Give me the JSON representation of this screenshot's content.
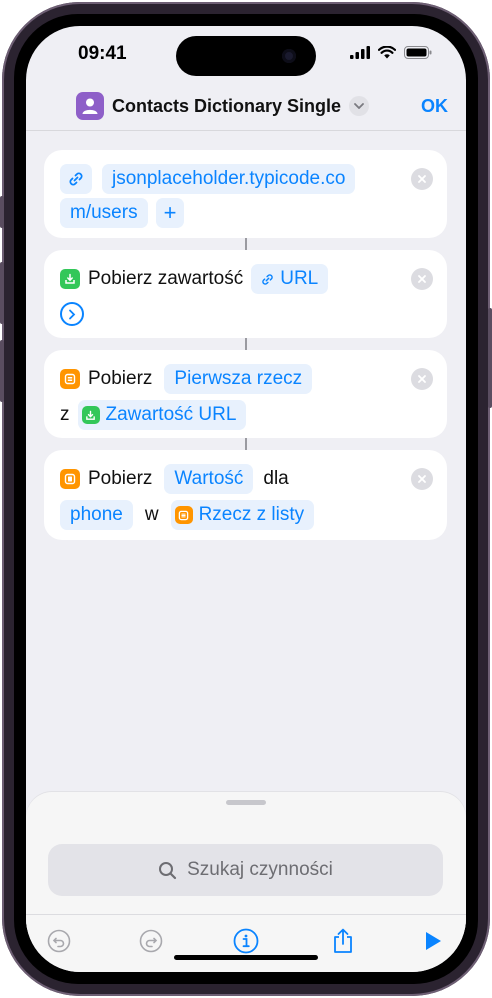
{
  "status_bar": {
    "time": "09:41"
  },
  "nav": {
    "title": "Contacts Dictionary Single",
    "done_label": "OK"
  },
  "actions": [
    {
      "kind": "url",
      "url_line1": "jsonplaceholder.typicode.co",
      "url_line2": "m/users",
      "add_label": "+"
    },
    {
      "kind": "get-contents",
      "label": "Pobierz zawartość",
      "param": "URL"
    },
    {
      "kind": "get-item",
      "label": "Pobierz",
      "param": "Pierwsza rzecz",
      "prep": "z",
      "source": "Zawartość URL"
    },
    {
      "kind": "get-value",
      "label": "Pobierz",
      "param": "Wartość",
      "prep1": "dla",
      "key": "phone",
      "prep2": "w",
      "source": "Rzecz z listy"
    }
  ],
  "sheet": {
    "search_placeholder": "Szukaj czynności"
  },
  "colors": {
    "accent": "#0a84ff",
    "green": "#33c759",
    "orange": "#ff9500",
    "app": "#8e5fc8"
  }
}
